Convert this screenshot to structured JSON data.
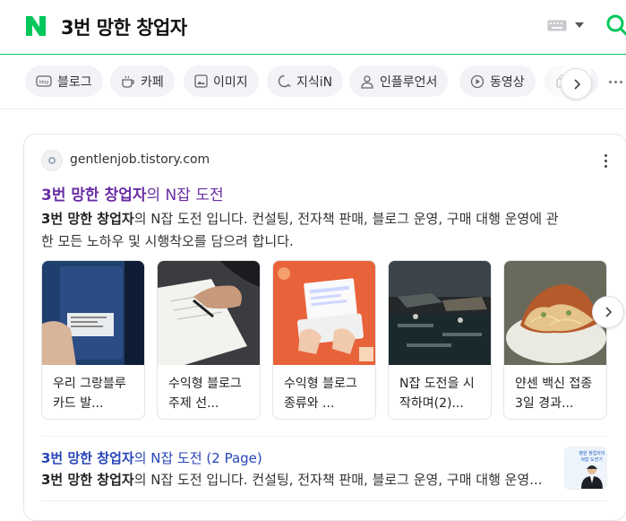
{
  "header": {
    "logo": "N",
    "query": "3번 망한 창업자",
    "brand_color": "#03c75a",
    "icons": [
      "keyboard-icon",
      "chevron-down-icon",
      "search-icon"
    ]
  },
  "tabs": [
    {
      "label": "블로그",
      "icon": "blog-icon"
    },
    {
      "label": "카페",
      "icon": "cafe-icon"
    },
    {
      "label": "이미지",
      "icon": "image-icon"
    },
    {
      "label": "지식iN",
      "icon": "kin-icon"
    },
    {
      "label": "인플루언서",
      "icon": "person-icon"
    },
    {
      "label": "동영상",
      "icon": "play-icon"
    },
    {
      "label": "",
      "icon": "shopping-icon"
    }
  ],
  "result": {
    "site": "gentlenjob.tistory.com",
    "title_bold": "3번 망한 창업자",
    "title_rest": "의 N잡 도전",
    "desc_line1_bold": "3번 망한 창업자",
    "desc_line1_rest": "의 N잡 도전 입니다. 컨설팅, 전자책 판매, 블로그 운영, 구매 대행 운영에 관",
    "desc_line2": "한 모든 노하우 및 시행착오를 담으려 합니다.",
    "thumbnails": [
      {
        "caption": "우리 그랑블루 카드 발..."
      },
      {
        "caption": "수익형 블로그 주제 선..."
      },
      {
        "caption": "수익형 블로그 종류와 ..."
      },
      {
        "caption": "N잡 도전을 시작하며(2)..."
      },
      {
        "caption": "얀센 백신 접종 3일 경과..."
      }
    ],
    "sub": {
      "title_bold": "3번 망한 창업자",
      "title_rest": "의 N잡 도전 (2 Page)",
      "desc_bold": "3번 망한 창업자",
      "desc_rest": "의 N잡 도전 입니다. 컨설팅, 전자책 판매, 블로그 운영, 구매 대행 운영...",
      "thumb_lines": [
        "병원 창업자의",
        "N잡 도전기"
      ]
    }
  }
}
